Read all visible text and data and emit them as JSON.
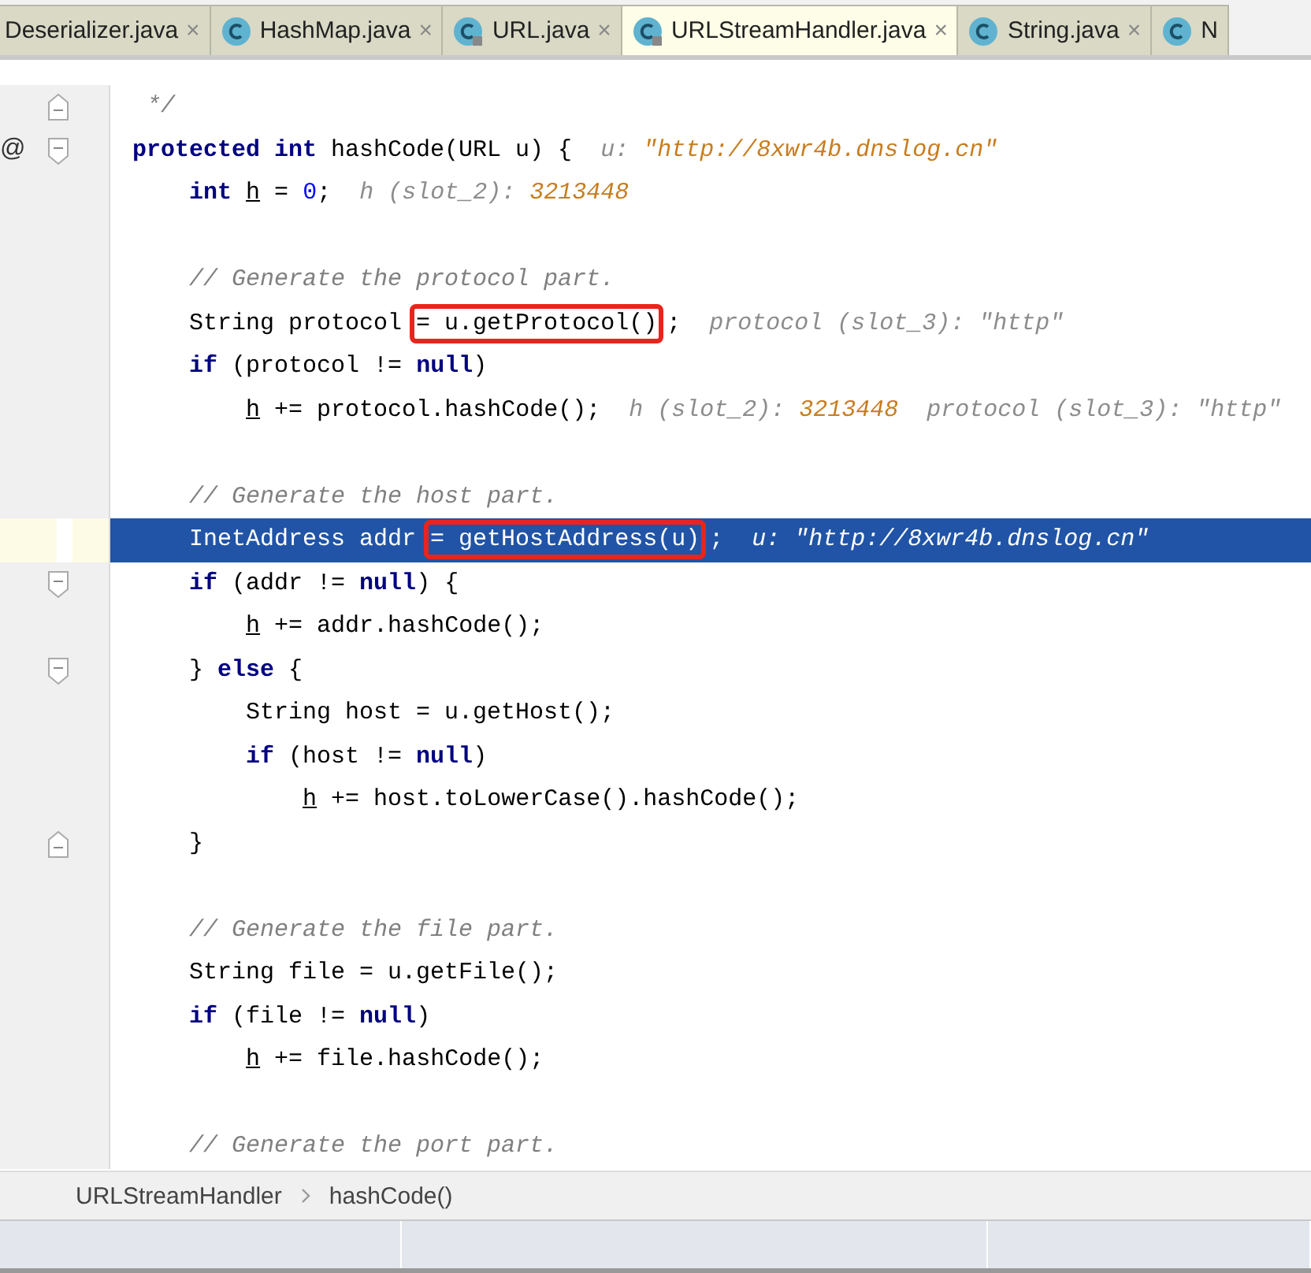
{
  "tabs": [
    {
      "label": "Deserializer.java",
      "kind": "plain",
      "close": "×",
      "selected": false
    },
    {
      "label": "HashMap.java",
      "kind": "class",
      "close": "×",
      "selected": false
    },
    {
      "label": "URL.java",
      "kind": "class_locked",
      "close": "×",
      "selected": false
    },
    {
      "label": "URLStreamHandler.java",
      "kind": "class_locked",
      "close": "×",
      "selected": true
    },
    {
      "label": "String.java",
      "kind": "class",
      "close": "×",
      "selected": false
    },
    {
      "label": "N",
      "kind": "class",
      "selected": false
    }
  ],
  "editor": {
    "lines": [
      {
        "current": false,
        "kind": "fold_end",
        "tokens": [
          {
            "kind": "comment",
            "text": "     */"
          }
        ]
      },
      {
        "current": false,
        "kind": "fold_start",
        "marker": "@",
        "tokens": [
          {
            "kind": "kw",
            "text": "    protected int "
          },
          {
            "kind": "plain",
            "text": "hashCode(URL u) {  "
          },
          {
            "kind": "hint",
            "text": "u: "
          },
          {
            "kind": "hint_value",
            "text": "\"http://8xwr4b.dnslog.cn\""
          }
        ]
      },
      {
        "current": false,
        "kind": "code",
        "tokens": [
          {
            "kind": "kw",
            "text": "        int "
          },
          {
            "kind": "var",
            "text": "h"
          },
          {
            "kind": "plain",
            "text": " = "
          },
          {
            "kind": "num",
            "text": "0"
          },
          {
            "kind": "plain",
            "text": ";  "
          },
          {
            "kind": "hint",
            "text": "h (slot_2): "
          },
          {
            "kind": "hint_value",
            "text": "3213448"
          }
        ]
      },
      {
        "current": false,
        "kind": "blank"
      },
      {
        "current": false,
        "kind": "code",
        "tokens": [
          {
            "kind": "comment",
            "text": "        // Generate the protocol part."
          }
        ]
      },
      {
        "current": false,
        "kind": "code",
        "tokens": [
          {
            "kind": "plain",
            "text": "        String protocol "
          },
          {
            "kind": "boxed",
            "text": "= u.getProtocol()"
          },
          {
            "kind": "plain",
            "text": ";  "
          },
          {
            "kind": "hint",
            "text": "protocol (slot_3): \"http\""
          }
        ]
      },
      {
        "current": false,
        "kind": "code",
        "tokens": [
          {
            "kind": "kw",
            "text": "        if "
          },
          {
            "kind": "plain",
            "text": "(protocol != "
          },
          {
            "kind": "kw",
            "text": "null"
          },
          {
            "kind": "plain",
            "text": ")"
          }
        ]
      },
      {
        "current": false,
        "kind": "code",
        "tokens": [
          {
            "kind": "var",
            "text": "            h"
          },
          {
            "kind": "plain",
            "text": " += protocol.hashCode();  "
          },
          {
            "kind": "hint",
            "text": "h (slot_2): "
          },
          {
            "kind": "hint_value",
            "text": "3213448"
          },
          {
            "kind": "hint",
            "text": "  protocol (slot_3): \"http\""
          }
        ]
      },
      {
        "current": false,
        "kind": "blank"
      },
      {
        "current": false,
        "kind": "code",
        "tokens": [
          {
            "kind": "comment",
            "text": "        // Generate the host part."
          }
        ]
      },
      {
        "current": true,
        "kind": "code",
        "tokens": [
          {
            "kind": "plain",
            "text": "        InetAddress addr "
          },
          {
            "kind": "boxed",
            "text": "= getHostAddress(u)"
          },
          {
            "kind": "plain",
            "text": ";  "
          },
          {
            "kind": "hint",
            "text": "u: "
          },
          {
            "kind": "hint_value",
            "text": "\"http://8xwr4b.dnslog.cn\""
          }
        ]
      },
      {
        "current": false,
        "kind": "fold_start",
        "tokens": [
          {
            "kind": "kw",
            "text": "        if "
          },
          {
            "kind": "plain",
            "text": "(addr != "
          },
          {
            "kind": "kw",
            "text": "null"
          },
          {
            "kind": "plain",
            "text": ") {"
          }
        ]
      },
      {
        "current": false,
        "kind": "code",
        "tokens": [
          {
            "kind": "var",
            "text": "            h"
          },
          {
            "kind": "plain",
            "text": " += addr.hashCode();"
          }
        ]
      },
      {
        "current": false,
        "kind": "fold_start",
        "tokens": [
          {
            "kind": "plain",
            "text": "        } "
          },
          {
            "kind": "kw",
            "text": "else "
          },
          {
            "kind": "plain",
            "text": "{"
          }
        ]
      },
      {
        "current": false,
        "kind": "code",
        "tokens": [
          {
            "kind": "plain",
            "text": "            String host = u.getHost();"
          }
        ]
      },
      {
        "current": false,
        "kind": "code",
        "tokens": [
          {
            "kind": "kw",
            "text": "            if "
          },
          {
            "kind": "plain",
            "text": "(host != "
          },
          {
            "kind": "kw",
            "text": "null"
          },
          {
            "kind": "plain",
            "text": ")"
          }
        ]
      },
      {
        "current": false,
        "kind": "code",
        "tokens": [
          {
            "kind": "var",
            "text": "                h"
          },
          {
            "kind": "plain",
            "text": " += host.toLowerCase().hashCode();"
          }
        ]
      },
      {
        "current": false,
        "kind": "fold_end",
        "tokens": [
          {
            "kind": "plain",
            "text": "        }"
          }
        ]
      },
      {
        "current": false,
        "kind": "blank"
      },
      {
        "current": false,
        "kind": "code",
        "tokens": [
          {
            "kind": "comment",
            "text": "        // Generate the file part."
          }
        ]
      },
      {
        "current": false,
        "kind": "code",
        "tokens": [
          {
            "kind": "plain",
            "text": "        String file = u.getFile();"
          }
        ]
      },
      {
        "current": false,
        "kind": "code",
        "tokens": [
          {
            "kind": "kw",
            "text": "        if "
          },
          {
            "kind": "plain",
            "text": "(file != "
          },
          {
            "kind": "kw",
            "text": "null"
          },
          {
            "kind": "plain",
            "text": ")"
          }
        ]
      },
      {
        "current": false,
        "kind": "code",
        "tokens": [
          {
            "kind": "var",
            "text": "            h"
          },
          {
            "kind": "plain",
            "text": " += file.hashCode();"
          }
        ]
      },
      {
        "current": false,
        "kind": "blank"
      },
      {
        "current": false,
        "kind": "code",
        "tokens": [
          {
            "kind": "comment",
            "text": "        // Generate the port part."
          }
        ]
      }
    ]
  },
  "breadcrumb": [
    "URLStreamHandler",
    "hashCode()"
  ]
}
